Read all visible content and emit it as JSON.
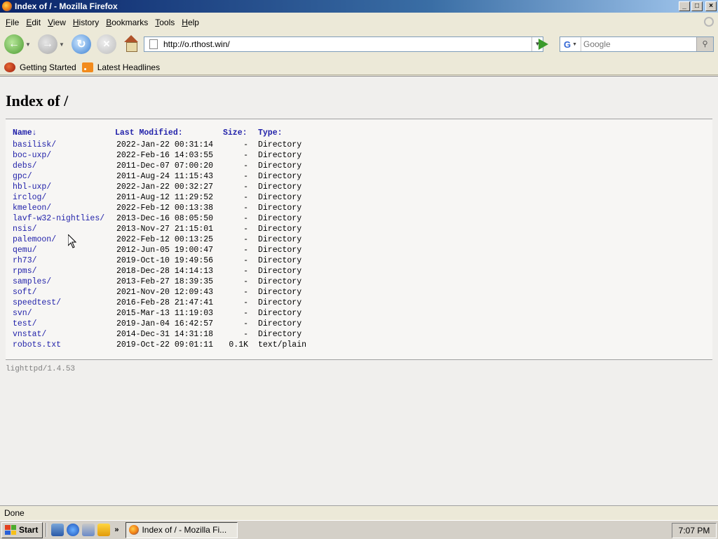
{
  "window": {
    "title": "Index of / - Mozilla Firefox",
    "controls": [
      "minimize",
      "maximize",
      "close"
    ]
  },
  "menubar": {
    "items": [
      {
        "label": "File"
      },
      {
        "label": "Edit"
      },
      {
        "label": "View"
      },
      {
        "label": "History"
      },
      {
        "label": "Bookmarks"
      },
      {
        "label": "Tools"
      },
      {
        "label": "Help"
      }
    ]
  },
  "toolbar": {
    "url": "http://o.rthost.win/",
    "search_placeholder": "Google",
    "search_engine_letter": "G"
  },
  "bookmarks": {
    "items": [
      {
        "label": "Getting Started",
        "icon": "firefox-icon"
      },
      {
        "label": "Latest Headlines",
        "icon": "rss-icon"
      }
    ]
  },
  "page": {
    "title": "Index of /",
    "columns": {
      "name": "Name↓",
      "modified": "Last Modified:",
      "size": "Size:",
      "type": "Type:"
    },
    "entries": [
      {
        "name": "basilisk/",
        "modified": "2022-Jan-22 00:31:14",
        "size": "-",
        "type": "Directory"
      },
      {
        "name": "boc-uxp/",
        "modified": "2022-Feb-16 14:03:55",
        "size": "-",
        "type": "Directory"
      },
      {
        "name": "debs/",
        "modified": "2011-Dec-07 07:00:20",
        "size": "-",
        "type": "Directory"
      },
      {
        "name": "gpc/",
        "modified": "2011-Aug-24 11:15:43",
        "size": "-",
        "type": "Directory"
      },
      {
        "name": "hbl-uxp/",
        "modified": "2022-Jan-22 00:32:27",
        "size": "-",
        "type": "Directory"
      },
      {
        "name": "irclog/",
        "modified": "2011-Aug-12 11:29:52",
        "size": "-",
        "type": "Directory"
      },
      {
        "name": "kmeleon/",
        "modified": "2022-Feb-12 00:13:38",
        "size": "-",
        "type": "Directory"
      },
      {
        "name": "lavf-w32-nightlies/",
        "modified": "2013-Dec-16 08:05:50",
        "size": "-",
        "type": "Directory"
      },
      {
        "name": "nsis/",
        "modified": "2013-Nov-27 21:15:01",
        "size": "-",
        "type": "Directory"
      },
      {
        "name": "palemoon/",
        "modified": "2022-Feb-12 00:13:25",
        "size": "-",
        "type": "Directory"
      },
      {
        "name": "qemu/",
        "modified": "2012-Jun-05 19:00:47",
        "size": "-",
        "type": "Directory"
      },
      {
        "name": "rh73/",
        "modified": "2019-Oct-10 19:49:56",
        "size": "-",
        "type": "Directory"
      },
      {
        "name": "rpms/",
        "modified": "2018-Dec-28 14:14:13",
        "size": "-",
        "type": "Directory"
      },
      {
        "name": "samples/",
        "modified": "2013-Feb-27 18:39:35",
        "size": "-",
        "type": "Directory"
      },
      {
        "name": "soft/",
        "modified": "2021-Nov-20 12:09:43",
        "size": "-",
        "type": "Directory"
      },
      {
        "name": "speedtest/",
        "modified": "2016-Feb-28 21:47:41",
        "size": "-",
        "type": "Directory"
      },
      {
        "name": "svn/",
        "modified": "2015-Mar-13 11:19:03",
        "size": "-",
        "type": "Directory"
      },
      {
        "name": "test/",
        "modified": "2019-Jan-04 16:42:57",
        "size": "-",
        "type": "Directory"
      },
      {
        "name": "vnstat/",
        "modified": "2014-Dec-31 14:31:18",
        "size": "-",
        "type": "Directory"
      },
      {
        "name": "robots.txt",
        "modified": "2019-Oct-22 09:01:11",
        "size": "0.1K",
        "type": "text/plain"
      }
    ],
    "server_footer": "lighttpd/1.4.53"
  },
  "statusbar": {
    "text": "Done"
  },
  "taskbar": {
    "start_label": "Start",
    "quick_launch_overflow": "»",
    "task_label": "Index of / - Mozilla Fi...",
    "clock": "7:07 PM"
  },
  "colors": {
    "link": "#2222aa",
    "header": "#1a1a9a",
    "titlebar_start": "#0a246a",
    "chrome": "#ece9d8"
  }
}
